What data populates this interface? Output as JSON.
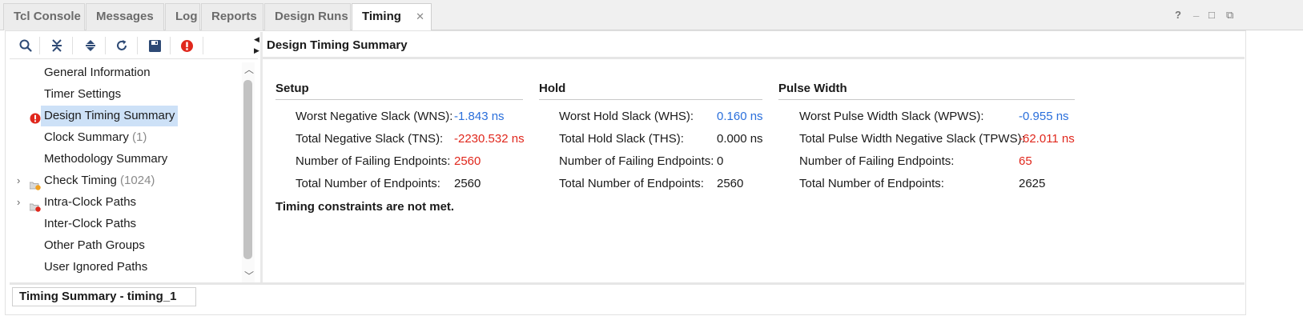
{
  "tabs": [
    {
      "label": "Tcl Console"
    },
    {
      "label": "Messages"
    },
    {
      "label": "Log"
    },
    {
      "label": "Reports"
    },
    {
      "label": "Design Runs"
    },
    {
      "label": "Timing",
      "active": true
    }
  ],
  "window_controls": {
    "help": "?",
    "minimize": "_",
    "maximize": "□",
    "restore": "⧉"
  },
  "toolbar_icons": [
    "search-icon",
    "collapse-all-icon",
    "expand-all-icon",
    "refresh-icon",
    "save-icon",
    "error-icon"
  ],
  "tree": {
    "items": [
      {
        "label": "General Information",
        "count": ""
      },
      {
        "label": "Timer Settings",
        "count": ""
      },
      {
        "label": "Design Timing Summary",
        "count": "",
        "selected": true,
        "icon": "error-icon"
      },
      {
        "label": "Clock Summary",
        "count": "(1)"
      },
      {
        "label": "Methodology Summary",
        "count": ""
      },
      {
        "label": "Check Timing",
        "count": "(1024)",
        "expandable": true,
        "icon": "folder-warning-icon"
      },
      {
        "label": "Intra-Clock Paths",
        "count": "",
        "expandable": true,
        "icon": "folder-error-icon"
      },
      {
        "label": "Inter-Clock Paths",
        "count": ""
      },
      {
        "label": "Other Path Groups",
        "count": ""
      },
      {
        "label": "User Ignored Paths",
        "count": ""
      }
    ]
  },
  "panel_title": "Design Timing Summary",
  "setup": {
    "title": "Setup",
    "rows": [
      {
        "label": "Worst Negative Slack (WNS):",
        "value": "-1.843 ns"
      },
      {
        "label": "Total Negative Slack (TNS):",
        "value": "-2230.532 ns"
      },
      {
        "label": "Number of Failing Endpoints:",
        "value": "2560"
      },
      {
        "label": "Total Number of Endpoints:",
        "value": "2560"
      }
    ]
  },
  "hold": {
    "title": "Hold",
    "rows": [
      {
        "label": "Worst Hold Slack (WHS):",
        "value": "0.160 ns"
      },
      {
        "label": "Total Hold Slack (THS):",
        "value": "0.000 ns"
      },
      {
        "label": "Number of Failing Endpoints:",
        "value": "0"
      },
      {
        "label": "Total Number of Endpoints:",
        "value": "2560"
      }
    ]
  },
  "pulse_width": {
    "title": "Pulse Width",
    "rows": [
      {
        "label": "Worst Pulse Width Slack (WPWS):",
        "value": "-0.955 ns"
      },
      {
        "label": "Total Pulse Width Negative Slack (TPWS):",
        "value": "-62.011 ns"
      },
      {
        "label": "Number of Failing Endpoints:",
        "value": "65"
      },
      {
        "label": "Total Number of Endpoints:",
        "value": "2625"
      }
    ]
  },
  "status_message": "Timing constraints are not met.",
  "bottom_tab": "Timing Summary - timing_1",
  "colors": {
    "link_blue": "#2a6fdb",
    "error_red": "#e0271c",
    "selection": "#cde1f7"
  }
}
